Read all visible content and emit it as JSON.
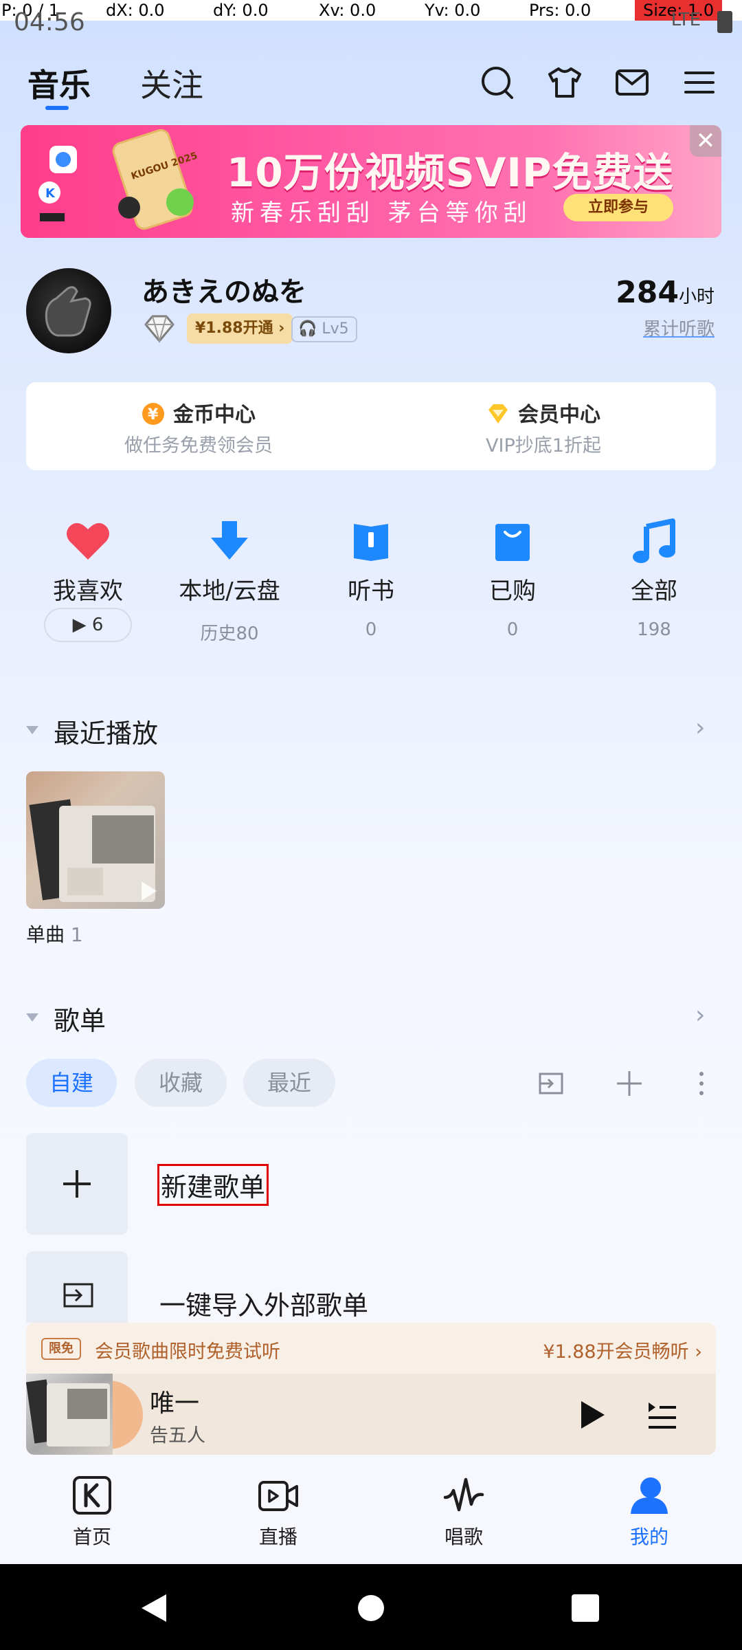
{
  "debug": {
    "p": "P: 0 / 1",
    "dx": "dX: 0.0",
    "dy": "dY: 0.0",
    "xv": "Xv: 0.0",
    "yv": "Yv: 0.0",
    "prs": "Prs: 0.0",
    "size": "Size: 1.0"
  },
  "status": {
    "time": "04:56",
    "network": "LTE"
  },
  "header": {
    "tabs": [
      "音乐",
      "关注"
    ],
    "active_tab": "音乐",
    "icons": [
      "search-icon",
      "tshirt-icon",
      "mail-icon",
      "menu-icon"
    ]
  },
  "banner": {
    "title": "10万份视频SVIP免费送",
    "subtitle": "新春乐刮刮  茅台等你刮",
    "cta": "立即参与",
    "close": "✕",
    "badge": "KUGOU 2025"
  },
  "profile": {
    "name": "あきえのぬを",
    "vip_open": "¥1.88开通",
    "level": "Lv5",
    "listen_hours": "284",
    "listen_unit": "小时",
    "listen_label": "累计听歌"
  },
  "centers": [
    {
      "title": "金币中心",
      "subtitle": "做任务免费领会员",
      "icon": "coin-icon"
    },
    {
      "title": "会员中心",
      "subtitle": "VIP抄底1折起",
      "icon": "vip-diamond-icon"
    }
  ],
  "quick": [
    {
      "label": "我喜欢",
      "count": "6",
      "icon": "heart-icon"
    },
    {
      "label": "本地/云盘",
      "count": "历史80",
      "icon": "download-icon"
    },
    {
      "label": "听书",
      "count": "0",
      "icon": "book-icon"
    },
    {
      "label": "已购",
      "count": "0",
      "icon": "bag-icon"
    },
    {
      "label": "全部",
      "count": "198",
      "icon": "music-note-icon"
    }
  ],
  "recent": {
    "title": "最近播放",
    "item_label": "单曲",
    "item_count": "1"
  },
  "playlists": {
    "title": "歌单",
    "tabs": [
      "自建",
      "收藏",
      "最近"
    ],
    "active_tab": "自建",
    "rows": [
      "新建歌单",
      "一键导入外部歌单"
    ]
  },
  "promo": {
    "tag": "限免",
    "text": "会员歌曲限时免费试听",
    "action": "¥1.88开会员畅听"
  },
  "player": {
    "title": "唯一",
    "artist": "告五人"
  },
  "nav": [
    {
      "label": "首页",
      "icon": "home-k-icon"
    },
    {
      "label": "直播",
      "icon": "live-video-icon"
    },
    {
      "label": "唱歌",
      "icon": "sing-wave-icon"
    },
    {
      "label": "我的",
      "icon": "person-icon"
    }
  ],
  "colors": {
    "accent": "#1d71ff",
    "banner": "#ff4f96",
    "heart": "#f5465a",
    "promo": "#b0602a"
  }
}
